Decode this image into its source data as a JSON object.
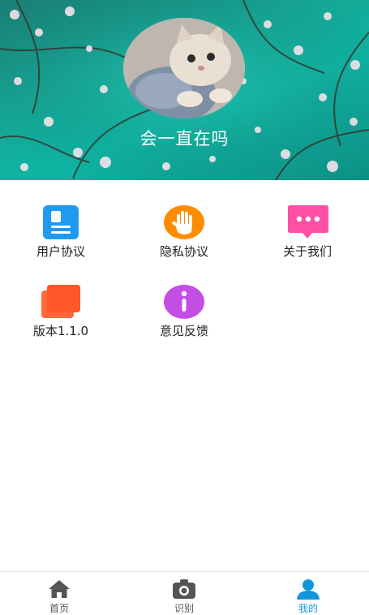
{
  "profile": {
    "nickname": "会一直在吗"
  },
  "menu": {
    "items": [
      {
        "label": "用户协议",
        "icon": "document-icon",
        "color": "#2196f3"
      },
      {
        "label": "隐私协议",
        "icon": "hand-icon",
        "color": "#ff8a00"
      },
      {
        "label": "关于我们",
        "icon": "chat-bubble-icon",
        "color": "#ff4fa6"
      },
      {
        "label": "版本1.1.0",
        "icon": "layers-icon",
        "color": "#ff5722"
      },
      {
        "label": "意见反馈",
        "icon": "info-icon",
        "color": "#c14ee2"
      }
    ]
  },
  "tabbar": {
    "tabs": [
      {
        "label": "首页",
        "icon": "home-icon",
        "active": false
      },
      {
        "label": "识别",
        "icon": "camera-icon",
        "active": false
      },
      {
        "label": "我的",
        "icon": "user-icon",
        "active": true
      }
    ],
    "active_color": "#1296db",
    "inactive_color": "#555555"
  }
}
